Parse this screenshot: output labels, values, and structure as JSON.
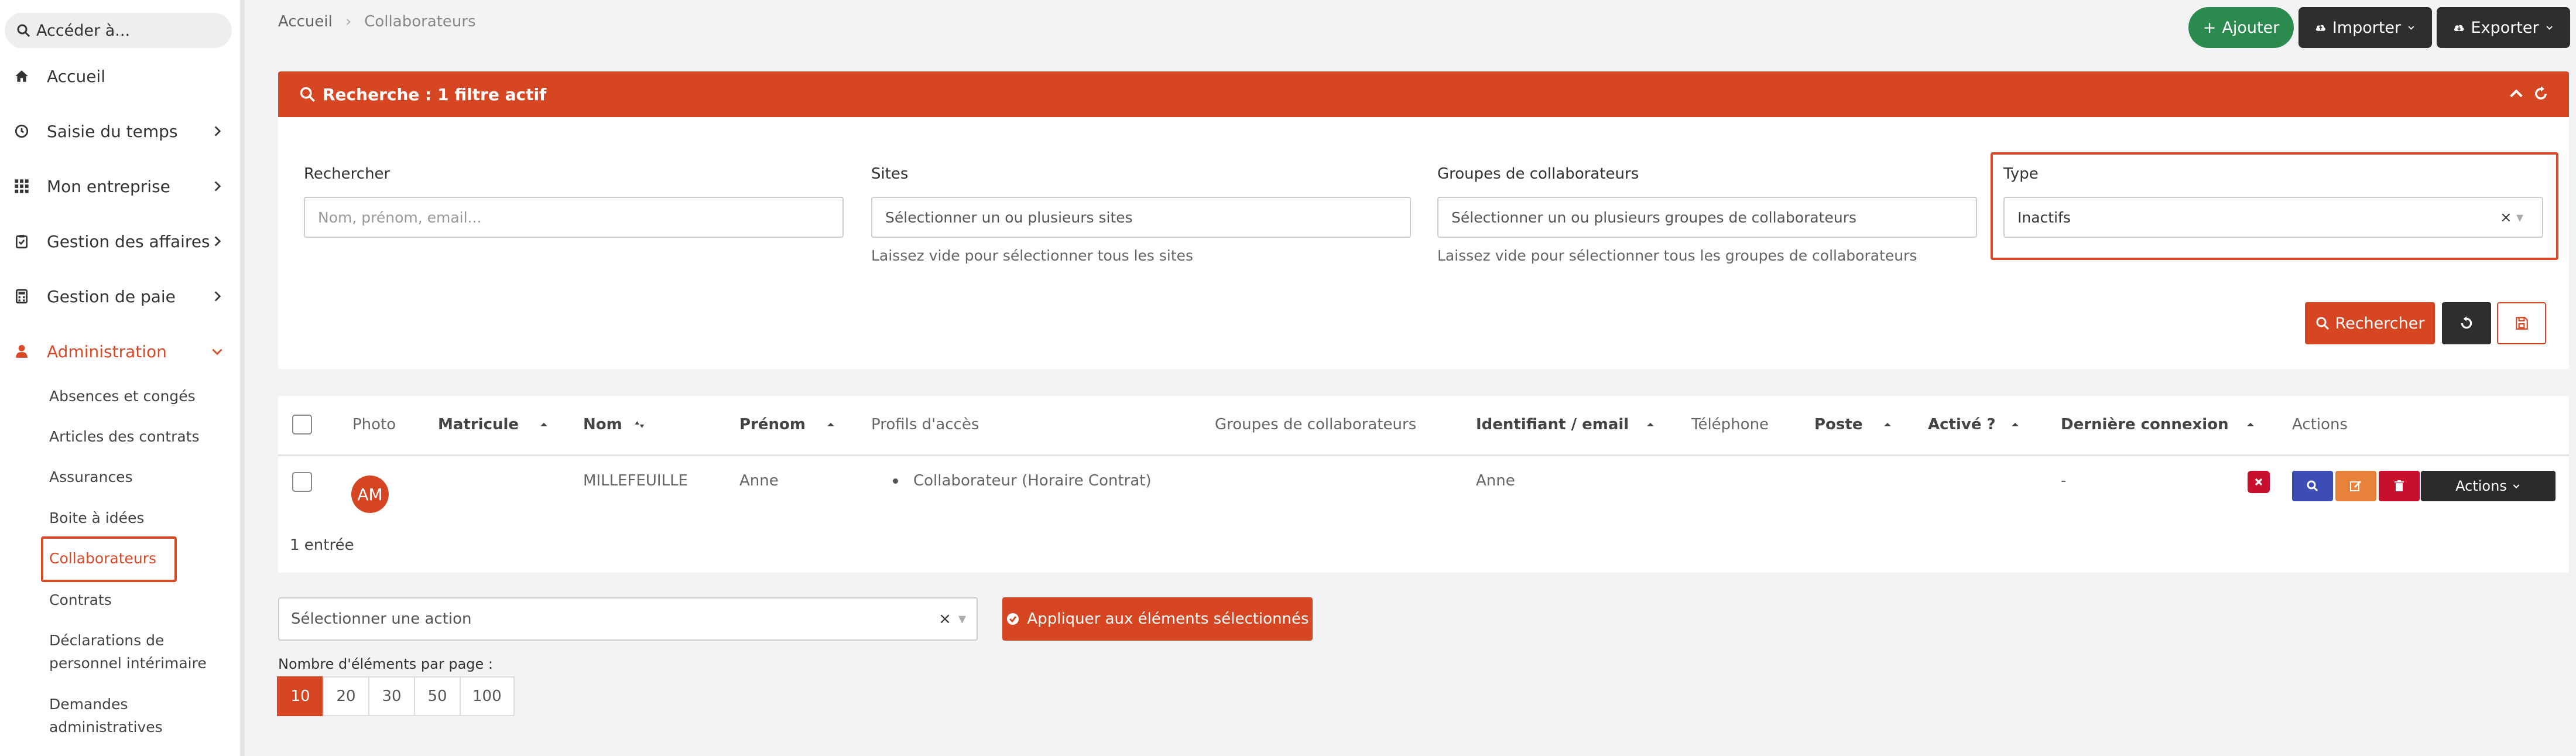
{
  "sidebar": {
    "search_placeholder": "Accéder à...",
    "items": [
      {
        "label": "Accueil",
        "icon": "home-icon"
      },
      {
        "label": "Saisie du temps",
        "icon": "clock-icon"
      },
      {
        "label": "Mon entreprise",
        "icon": "grid-icon"
      },
      {
        "label": "Gestion des affaires",
        "icon": "clipboard-icon"
      },
      {
        "label": "Gestion de paie",
        "icon": "calculator-icon"
      },
      {
        "label": "Administration",
        "icon": "user-tie-icon"
      }
    ],
    "sub_items": [
      "Absences et congés",
      "Articles des contrats",
      "Assurances",
      "Boite à idées",
      "Collaborateurs",
      "Contrats",
      "Déclarations de",
      "personnel intérimaire",
      "Demandes",
      "administratives"
    ]
  },
  "breadcrumb": {
    "home": "Accueil",
    "current": "Collaborateurs"
  },
  "top_actions": {
    "add": "Ajouter",
    "import": "Importer",
    "export": "Exporter"
  },
  "search_panel": {
    "title": "Recherche : 1 filtre actif",
    "fields": {
      "search": {
        "label": "Rechercher",
        "placeholder": "Nom, prénom, email..."
      },
      "sites": {
        "label": "Sites",
        "placeholder": "Sélectionner un ou plusieurs sites",
        "help": "Laissez vide pour sélectionner tous les sites"
      },
      "groups": {
        "label": "Groupes de collaborateurs",
        "placeholder": "Sélectionner un ou plusieurs groupes de collaborateurs",
        "help": "Laissez vide pour sélectionner tous les groupes de collaborateurs"
      },
      "type": {
        "label": "Type",
        "value": "Inactifs"
      }
    },
    "search_button": "Rechercher"
  },
  "table": {
    "headers": {
      "photo": "Photo",
      "matricule": "Matricule",
      "nom": "Nom",
      "prenom": "Prénom",
      "profils": "Profils d'accès",
      "groupes": "Groupes de collaborateurs",
      "identifiant": "Identifiant / email",
      "telephone": "Téléphone",
      "poste": "Poste",
      "active": "Activé ?",
      "derniere": "Dernière connexion",
      "actions": "Actions"
    },
    "rows": [
      {
        "initials": "AM",
        "matricule": "",
        "nom": "MILLEFEUILLE",
        "prenom": "Anne",
        "profil": "Collaborateur (Horaire Contrat)",
        "identifiant": "Anne",
        "derniere": "-",
        "actions_label": "Actions"
      }
    ],
    "entries": "1 entrée"
  },
  "bulk": {
    "select_placeholder": "Sélectionner une action",
    "apply": "Appliquer aux éléments sélectionnés"
  },
  "pagination": {
    "label": "Nombre d'éléments par page :",
    "options": [
      "10",
      "20",
      "30",
      "50",
      "100"
    ],
    "selected": "10"
  },
  "colors": {
    "accent": "#d74622",
    "green": "#2b8a4e",
    "dark": "#2e2e2e",
    "view": "#3d4db7",
    "edit": "#e8813a",
    "delete": "#c8102e"
  }
}
